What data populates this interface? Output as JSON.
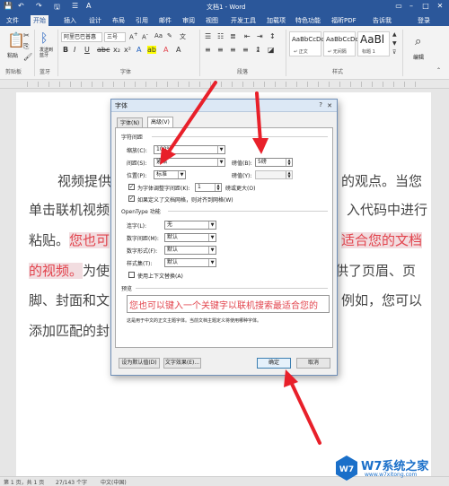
{
  "titlebar": {
    "title": "文档1 - Word",
    "quick_access": [
      "💾",
      "↶",
      "↷",
      "🖫",
      "☰",
      "A"
    ]
  },
  "tabs": [
    "文件",
    "开始",
    "插入",
    "设计",
    "布局",
    "引用",
    "邮件",
    "审阅",
    "视图",
    "开发工具",
    "加载项",
    "特色功能",
    "福昕PDF",
    "告诉我",
    "登录"
  ],
  "ribbon": {
    "paste_label": "粘贴",
    "clipboard_label": "剪贴板",
    "bluetooth_label": "发送到蓝牙",
    "bluetooth_short": "蓝牙",
    "font_name": "阿里巴巴普惠",
    "font_size": "三号",
    "font_group_label": "字体",
    "para_group_label": "段落",
    "styles_group_label": "样式",
    "style_items": [
      {
        "sample": "AaBbCcDc",
        "name": "↵ 正文"
      },
      {
        "sample": "AaBbCcDc",
        "name": "↵ 无间隔"
      },
      {
        "sample": "AaBl",
        "name": "标题 1"
      }
    ],
    "edit_label": "编辑"
  },
  "document": {
    "line1": "视频提供",
    "line1_end": "的观点。当您",
    "line2": "单击联机视频",
    "line2_end": "入代码中进行",
    "line3": "粘贴。",
    "line3_hl": "您也可",
    "line3_end_hl": "适合您的文档",
    "line4_hl": "的视频。",
    "line4": "为使",
    "line4_end": "供了页眉、页",
    "line5": "脚、封面和文",
    "line5_end": "例如，您可以",
    "line6": "添加匹配的封"
  },
  "dialog": {
    "title": "字体",
    "help": "?",
    "close": "✕",
    "tab_font": "字体(N)",
    "tab_advanced": "高级(V)",
    "spacing_section": "字符间距",
    "scale_label": "缩放(C):",
    "scale_value": "100%",
    "spacing_label": "间距(S):",
    "spacing_value": "紧缩",
    "spacing_by_label": "磅值(B):",
    "spacing_by_value": "5磅",
    "position_label": "位置(P):",
    "position_value": "标准",
    "position_by_label": "磅值(Y):",
    "position_by_value": "",
    "kerning_label": "为字体调整字间距(K):",
    "kerning_value": "1",
    "kerning_suffix": "磅或更大(O)",
    "grid_label": "如果定义了文档网格，则对齐到网格(W)",
    "opentype_section": "OpenType 功能",
    "ligatures_label": "连字(L):",
    "ligatures_value": "无",
    "num_spacing_label": "数字间距(M):",
    "num_spacing_value": "默认",
    "num_forms_label": "数字形式(F):",
    "num_forms_value": "默认",
    "stylistic_label": "样式集(T):",
    "stylistic_value": "默认",
    "contextual_label": "使用上下文替换(A)",
    "preview_section": "预览",
    "preview_text": "您也可以键入一个关键字以联机搜索最适合您的",
    "preview_note": "这是用于中文的正文主题字体。当前文档主题定义将使用哪种字体。",
    "btn_default": "设为默认值(D)",
    "btn_effects": "文字效果(E)...",
    "btn_ok": "确定",
    "btn_cancel": "取消"
  },
  "statusbar": {
    "page": "第 1 页，共 1 页",
    "words": "27/143 个字",
    "lang": "中文(中国)"
  },
  "watermark": {
    "name": "W7系统之家",
    "url": "www.w7xitong.com"
  },
  "colors": {
    "accent": "#2b579a",
    "highlight_text": "#e2434c",
    "arrow": "#e8202a"
  }
}
